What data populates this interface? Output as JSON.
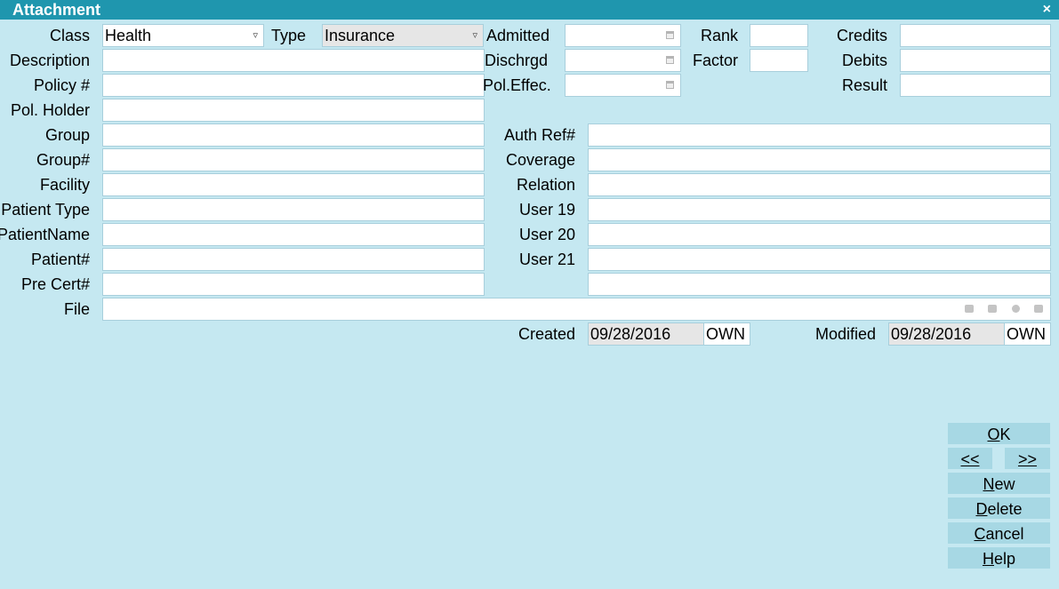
{
  "window": {
    "title": "Attachment",
    "close": "×"
  },
  "labels": {
    "class": "Class",
    "type": "Type",
    "admitted": "Admitted",
    "rank": "Rank",
    "credits": "Credits",
    "description": "Description",
    "dischrgd": "Dischrgd",
    "factor": "Factor",
    "debits": "Debits",
    "policy": "Policy #",
    "pol_effec": "Pol.Effec.",
    "result": "Result",
    "pol_holder": "Pol. Holder",
    "group": "Group",
    "auth_ref": "Auth Ref#",
    "group_num": "Group#",
    "coverage": "Coverage",
    "facility": "Facility",
    "relation": "Relation",
    "patient_type": "Patient Type",
    "user19": "User 19",
    "patient_name": "PatientName",
    "user20": "User 20",
    "patient_num": "Patient#",
    "user21": "User 21",
    "pre_cert": "Pre Cert#",
    "file": "File",
    "created": "Created",
    "modified": "Modified"
  },
  "values": {
    "class": "Health",
    "type": "Insurance",
    "created_date": "09/28/2016",
    "created_by": "OWN",
    "modified_date": "09/28/2016",
    "modified_by": "OWN"
  },
  "buttons": {
    "ok": {
      "u": "O",
      "rest": "K"
    },
    "prev": {
      "u": "<<"
    },
    "next": {
      "u": ">>"
    },
    "new": {
      "u": "N",
      "rest": "ew"
    },
    "delete": {
      "u": "D",
      "rest": "elete"
    },
    "cancel": {
      "u": "C",
      "rest": "ancel"
    },
    "help": {
      "u": "H",
      "rest": "elp"
    }
  }
}
